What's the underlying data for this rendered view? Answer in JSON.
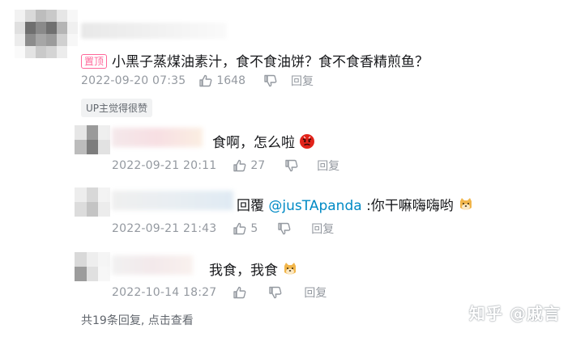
{
  "main_comment": {
    "pin_badge": "置顶",
    "text": "小黑子蒸煤油素汁，食不食油饼？食不食香精煎鱼？",
    "date": "2022-09-20 07:35",
    "likes": "1648",
    "reply_label": "回复",
    "up_tag": "UP主觉得很赞"
  },
  "replies": [
    {
      "text": "食啊，怎么啦",
      "emoji": "angry-face-icon",
      "date": "2022-09-21 20:11",
      "likes": "27",
      "reply_label": "回复"
    },
    {
      "prefix": "回覆",
      "mention": "@jusTApanda",
      "text": ":你干嘛嗨嗨哟",
      "emoji": "doge-icon",
      "date": "2022-09-21 21:43",
      "likes": "5",
      "reply_label": "回复"
    },
    {
      "text": "我食，我食",
      "emoji": "doge-icon",
      "date": "2022-10-14 18:27",
      "likes": "",
      "reply_label": "回复"
    }
  ],
  "more_replies": "共19条回复, 点击查看",
  "watermark": "知乎 @戚言",
  "colors": {
    "pin": "#ff6699",
    "mention": "#008ac5",
    "meta": "#9499a0"
  }
}
